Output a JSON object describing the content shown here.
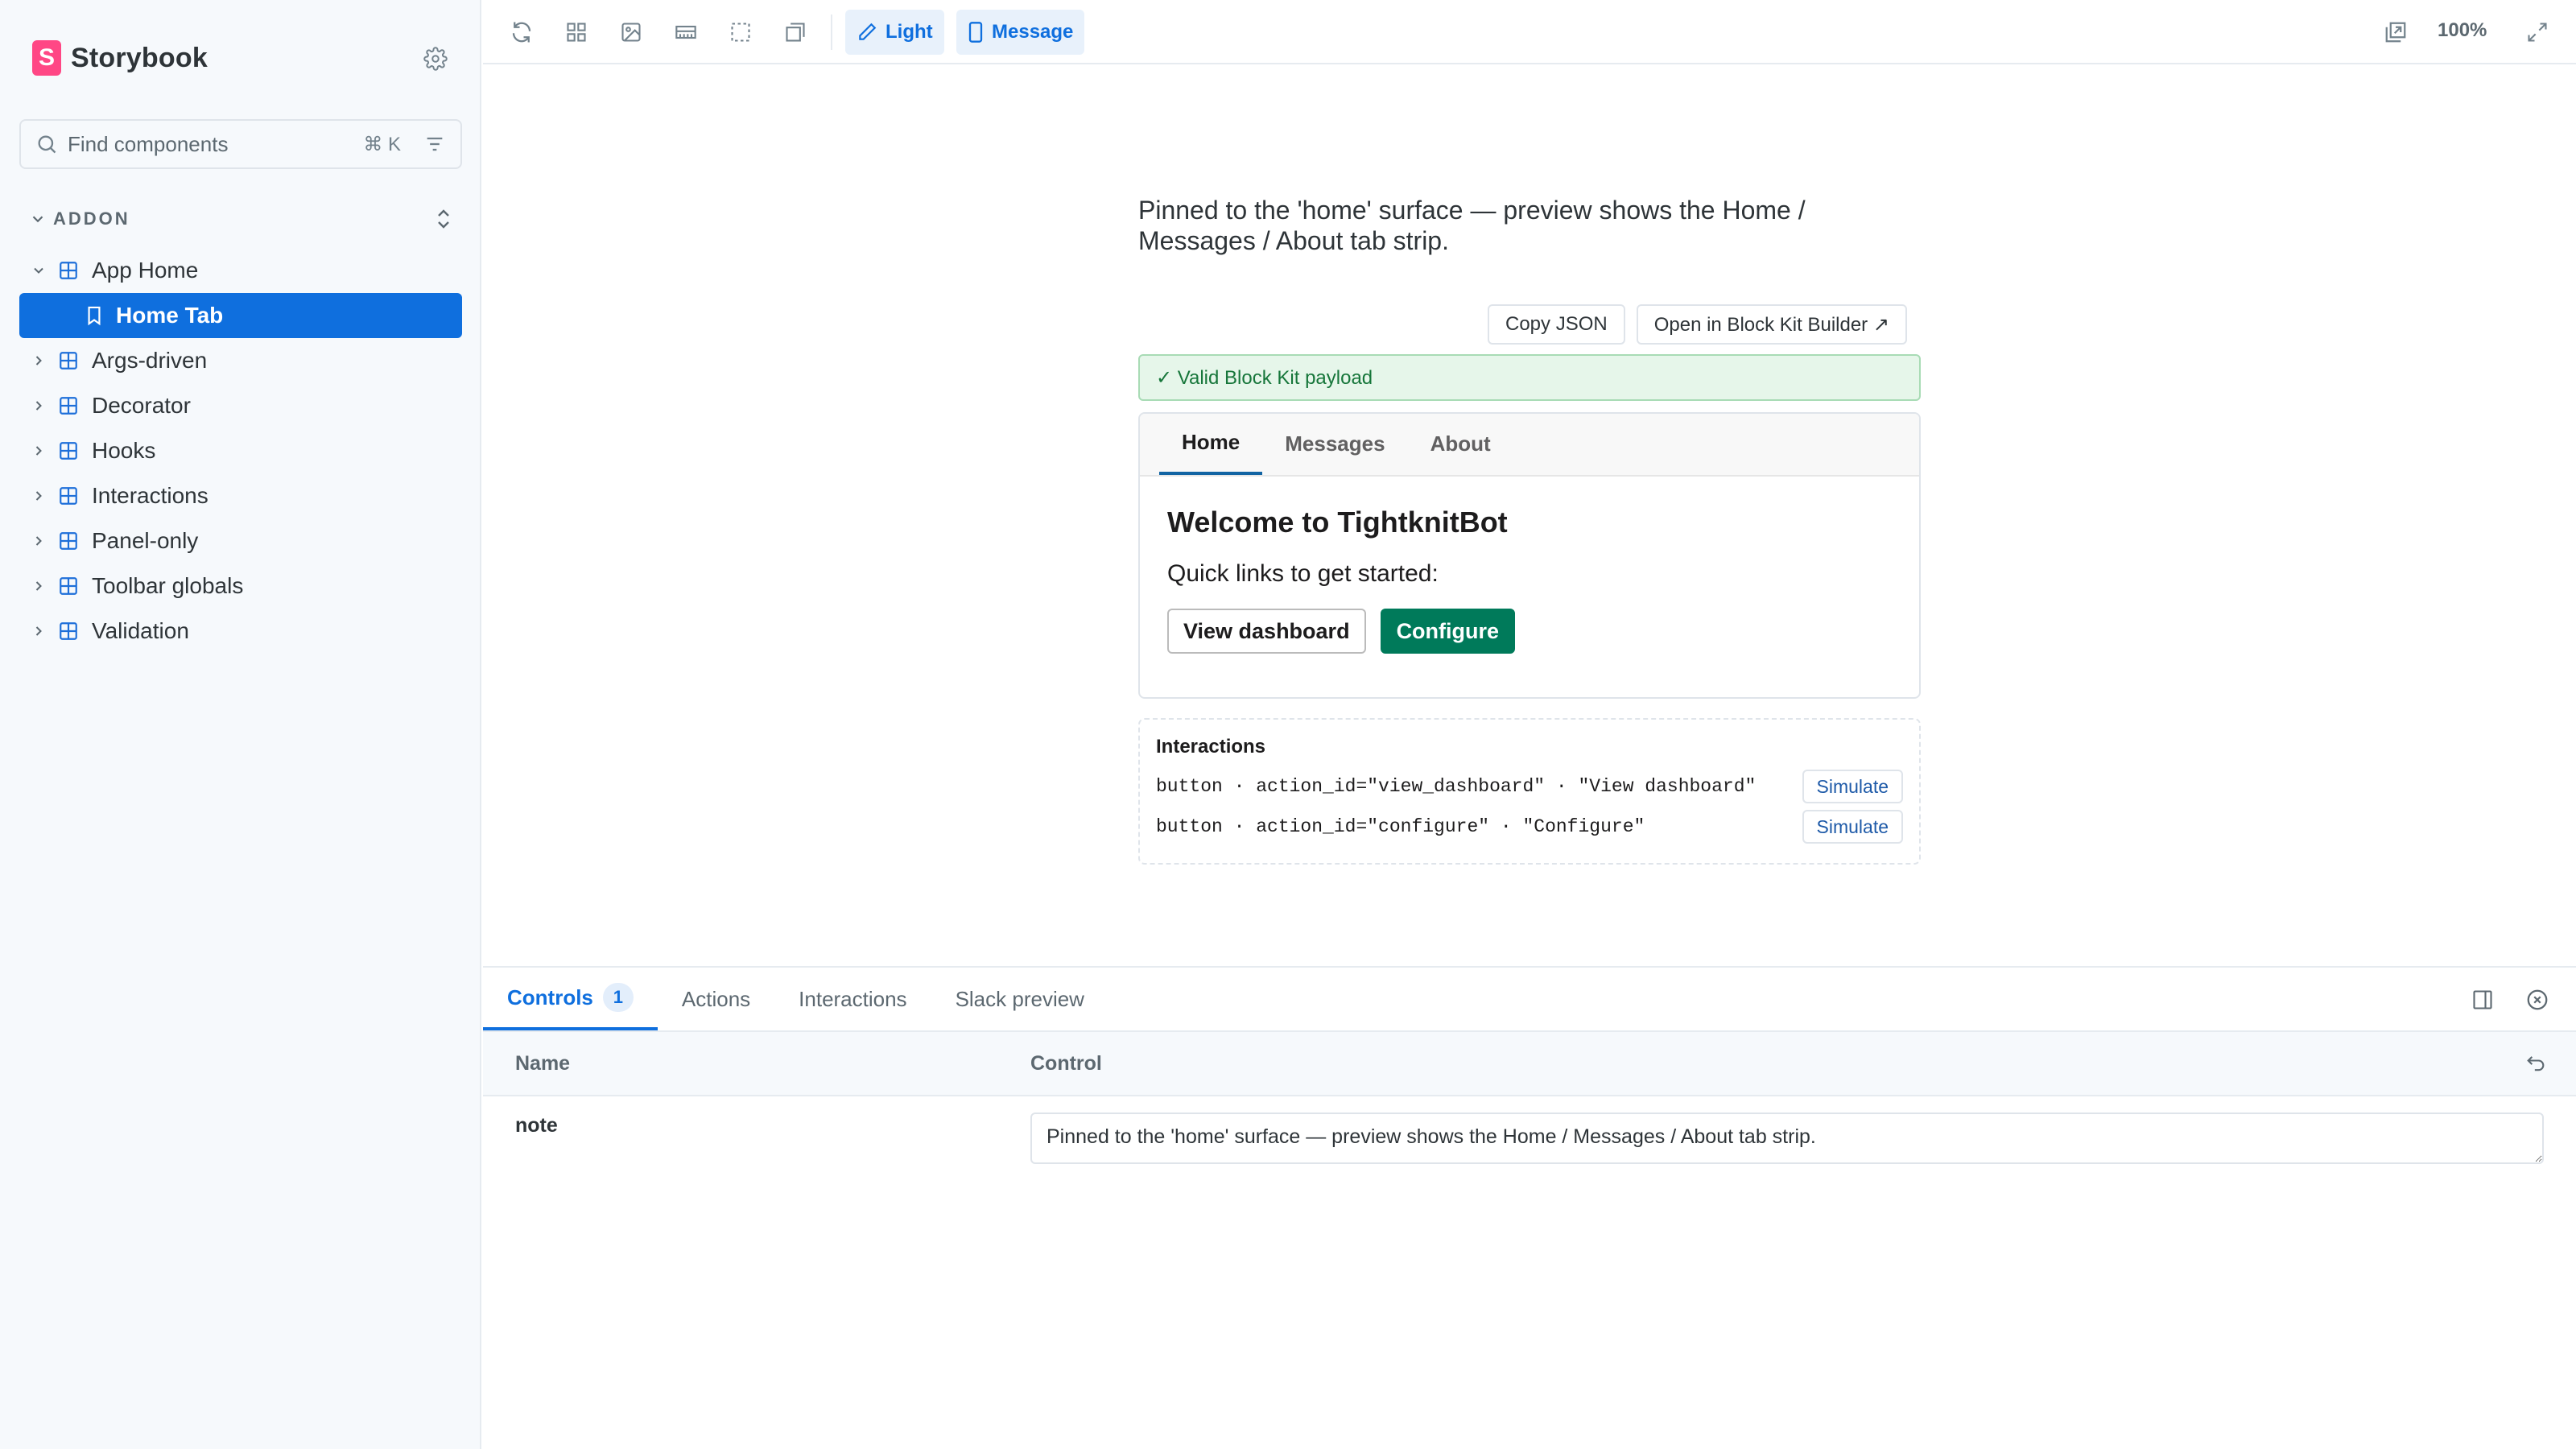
{
  "brand": {
    "name": "Storybook",
    "mark": "S"
  },
  "sidebar": {
    "search": {
      "placeholder": "Find components",
      "shortcut": "⌘ K"
    },
    "group_label": "ADDON",
    "items": [
      {
        "label": "App Home",
        "expanded": true
      },
      {
        "label": "Home Tab",
        "selected": true
      },
      {
        "label": "Args-driven"
      },
      {
        "label": "Decorator"
      },
      {
        "label": "Hooks"
      },
      {
        "label": "Interactions"
      },
      {
        "label": "Panel-only"
      },
      {
        "label": "Toolbar globals"
      },
      {
        "label": "Validation"
      }
    ]
  },
  "toolbar": {
    "theme_label": "Light",
    "surface_label": "Message",
    "zoom": "100%"
  },
  "preview": {
    "note": "Pinned to the 'home' surface — preview shows the Home / Messages / About tab strip.",
    "copy_json": "Copy JSON",
    "open_builder": "Open in Block Kit Builder ↗",
    "valid_banner": "✓ Valid Block Kit payload",
    "slack": {
      "tabs": [
        "Home",
        "Messages",
        "About"
      ],
      "active_tab": "Home",
      "heading": "Welcome to TightknitBot",
      "text": "Quick links to get started:",
      "buttons": [
        {
          "label": "View dashboard",
          "style": "default"
        },
        {
          "label": "Configure",
          "style": "primary"
        }
      ]
    },
    "interactions": {
      "title": "Interactions",
      "rows": [
        {
          "code": "button · action_id=\"view_dashboard\" · \"View dashboard\"",
          "action": "Simulate"
        },
        {
          "code": "button · action_id=\"configure\" · \"Configure\"",
          "action": "Simulate"
        }
      ]
    }
  },
  "panel": {
    "tabs": [
      {
        "label": "Controls",
        "badge": "1",
        "active": true
      },
      {
        "label": "Actions"
      },
      {
        "label": "Interactions"
      },
      {
        "label": "Slack preview"
      }
    ],
    "columns": {
      "name": "Name",
      "control": "Control"
    },
    "rows": [
      {
        "name": "note",
        "value": "Pinned to the 'home' surface — preview shows the Home / Messages / About tab strip."
      }
    ]
  },
  "colors": {
    "accent": "#0f6fde",
    "brand": "#ff4785",
    "slack_primary": "#007a5a",
    "valid": "#16763a"
  }
}
